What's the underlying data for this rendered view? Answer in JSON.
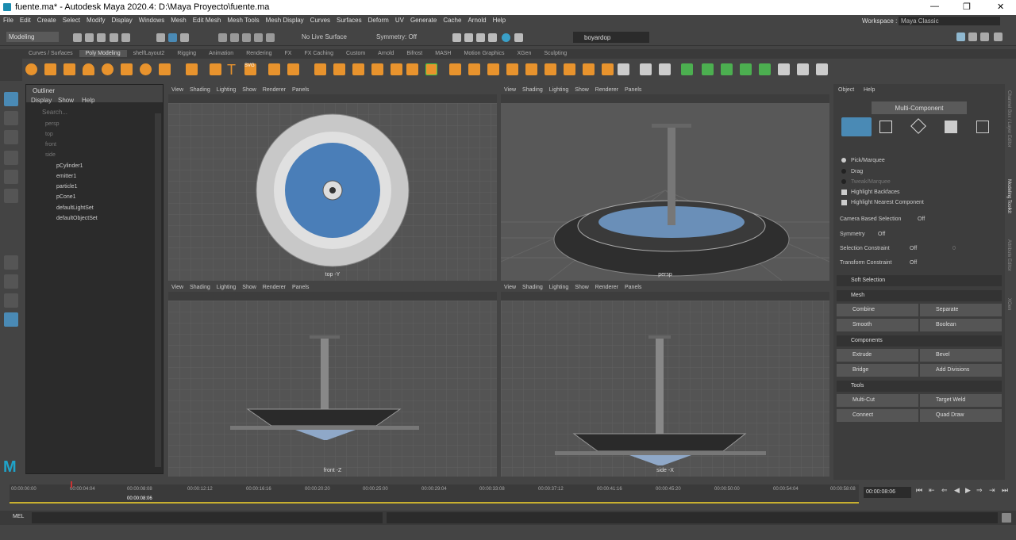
{
  "window": {
    "title": "fuente.ma* - Autodesk Maya 2020.4: D:\\Maya Proyecto\\fuente.ma",
    "min": "—",
    "max": "❐",
    "close": "✕"
  },
  "menu": [
    "File",
    "Edit",
    "Create",
    "Select",
    "Modify",
    "Display",
    "Windows",
    "Mesh",
    "Edit Mesh",
    "Mesh Tools",
    "Mesh Display",
    "Curves",
    "Surfaces",
    "Deform",
    "UV",
    "Generate",
    "Cache",
    "Arnold",
    "Help"
  ],
  "workspace": {
    "label": "Workspace :",
    "value": "Maya Classic"
  },
  "status": {
    "menuset": "Modeling",
    "live": "No Live Surface",
    "symmetry": "Symmetry: Off",
    "user": "boyardop"
  },
  "shelf_tabs": [
    "Curves / Surfaces",
    "Poly Modeling",
    "shelfLayout2",
    "Rigging",
    "Animation",
    "Rendering",
    "FX",
    "FX Caching",
    "Custom",
    "Arnold",
    "Bifrost",
    "MASH",
    "Motion Graphics",
    "XGen",
    "Sculpting"
  ],
  "shelf_active": 1,
  "outliner": {
    "title": "Outliner",
    "menu": [
      "Display",
      "Show",
      "Help"
    ],
    "search": "Search...",
    "items": [
      "persp",
      "top",
      "front",
      "side",
      "pCylinder1",
      "emitter1",
      "particle1",
      "pCone1",
      "defaultLightSet",
      "defaultObjectSet"
    ]
  },
  "viewport_menu": [
    "View",
    "Shading",
    "Lighting",
    "Show",
    "Renderer",
    "Panels"
  ],
  "viewports": {
    "top": "top -Y",
    "persp": "persp",
    "front": "front -Z",
    "side": "side -X"
  },
  "modeling_toolkit": {
    "menu": [
      "Object",
      "Help"
    ],
    "mode": "Multi-Component",
    "options": [
      "Pick/Marquee",
      "Drag",
      "Tweak/Marquee",
      "Highlight Backfaces",
      "Highlight Nearest Component"
    ],
    "camera_sel": "Camera Based Selection",
    "camera_sel_val": "Off",
    "symmetry": "Symmetry",
    "symmetry_val": "Off",
    "sel_constraint": "Selection Constraint",
    "sel_constraint_val": "Off",
    "sel_constraint_num": "0",
    "transform_constraint": "Transform Constraint",
    "transform_constraint_val": "Off",
    "soft_selection": "Soft Selection",
    "mesh": "Mesh",
    "combine": "Combine",
    "separate": "Separate",
    "smooth": "Smooth",
    "boolean": "Boolean",
    "components": "Components",
    "extrude": "Extrude",
    "bevel": "Bevel",
    "bridge": "Bridge",
    "add_divisions": "Add Divisions",
    "tools": "Tools",
    "multi_cut": "Multi-Cut",
    "target_weld": "Target Weld",
    "connect": "Connect",
    "quad_draw": "Quad Draw"
  },
  "side_tabs": [
    "Channel Box / Layer Editor",
    "Modeling Toolkit",
    "Attribute Editor",
    "XGen"
  ],
  "timeline": {
    "ticks": [
      "00:00:00:00",
      "00:00:04:04",
      "00:00:08:08",
      "00:00:12:12",
      "00:00:16:16",
      "00:00:20:20",
      "00:00:25:00",
      "00:00:29:04",
      "00:00:33:08",
      "00:00:37:12",
      "00:00:41:16",
      "00:00:45:20",
      "00:00:50:00",
      "00:00:54:04",
      "00:00:58:08"
    ],
    "current_marker": "00:00:08:06",
    "current": "00:00:08:06"
  },
  "cmd": {
    "label": "MEL"
  }
}
